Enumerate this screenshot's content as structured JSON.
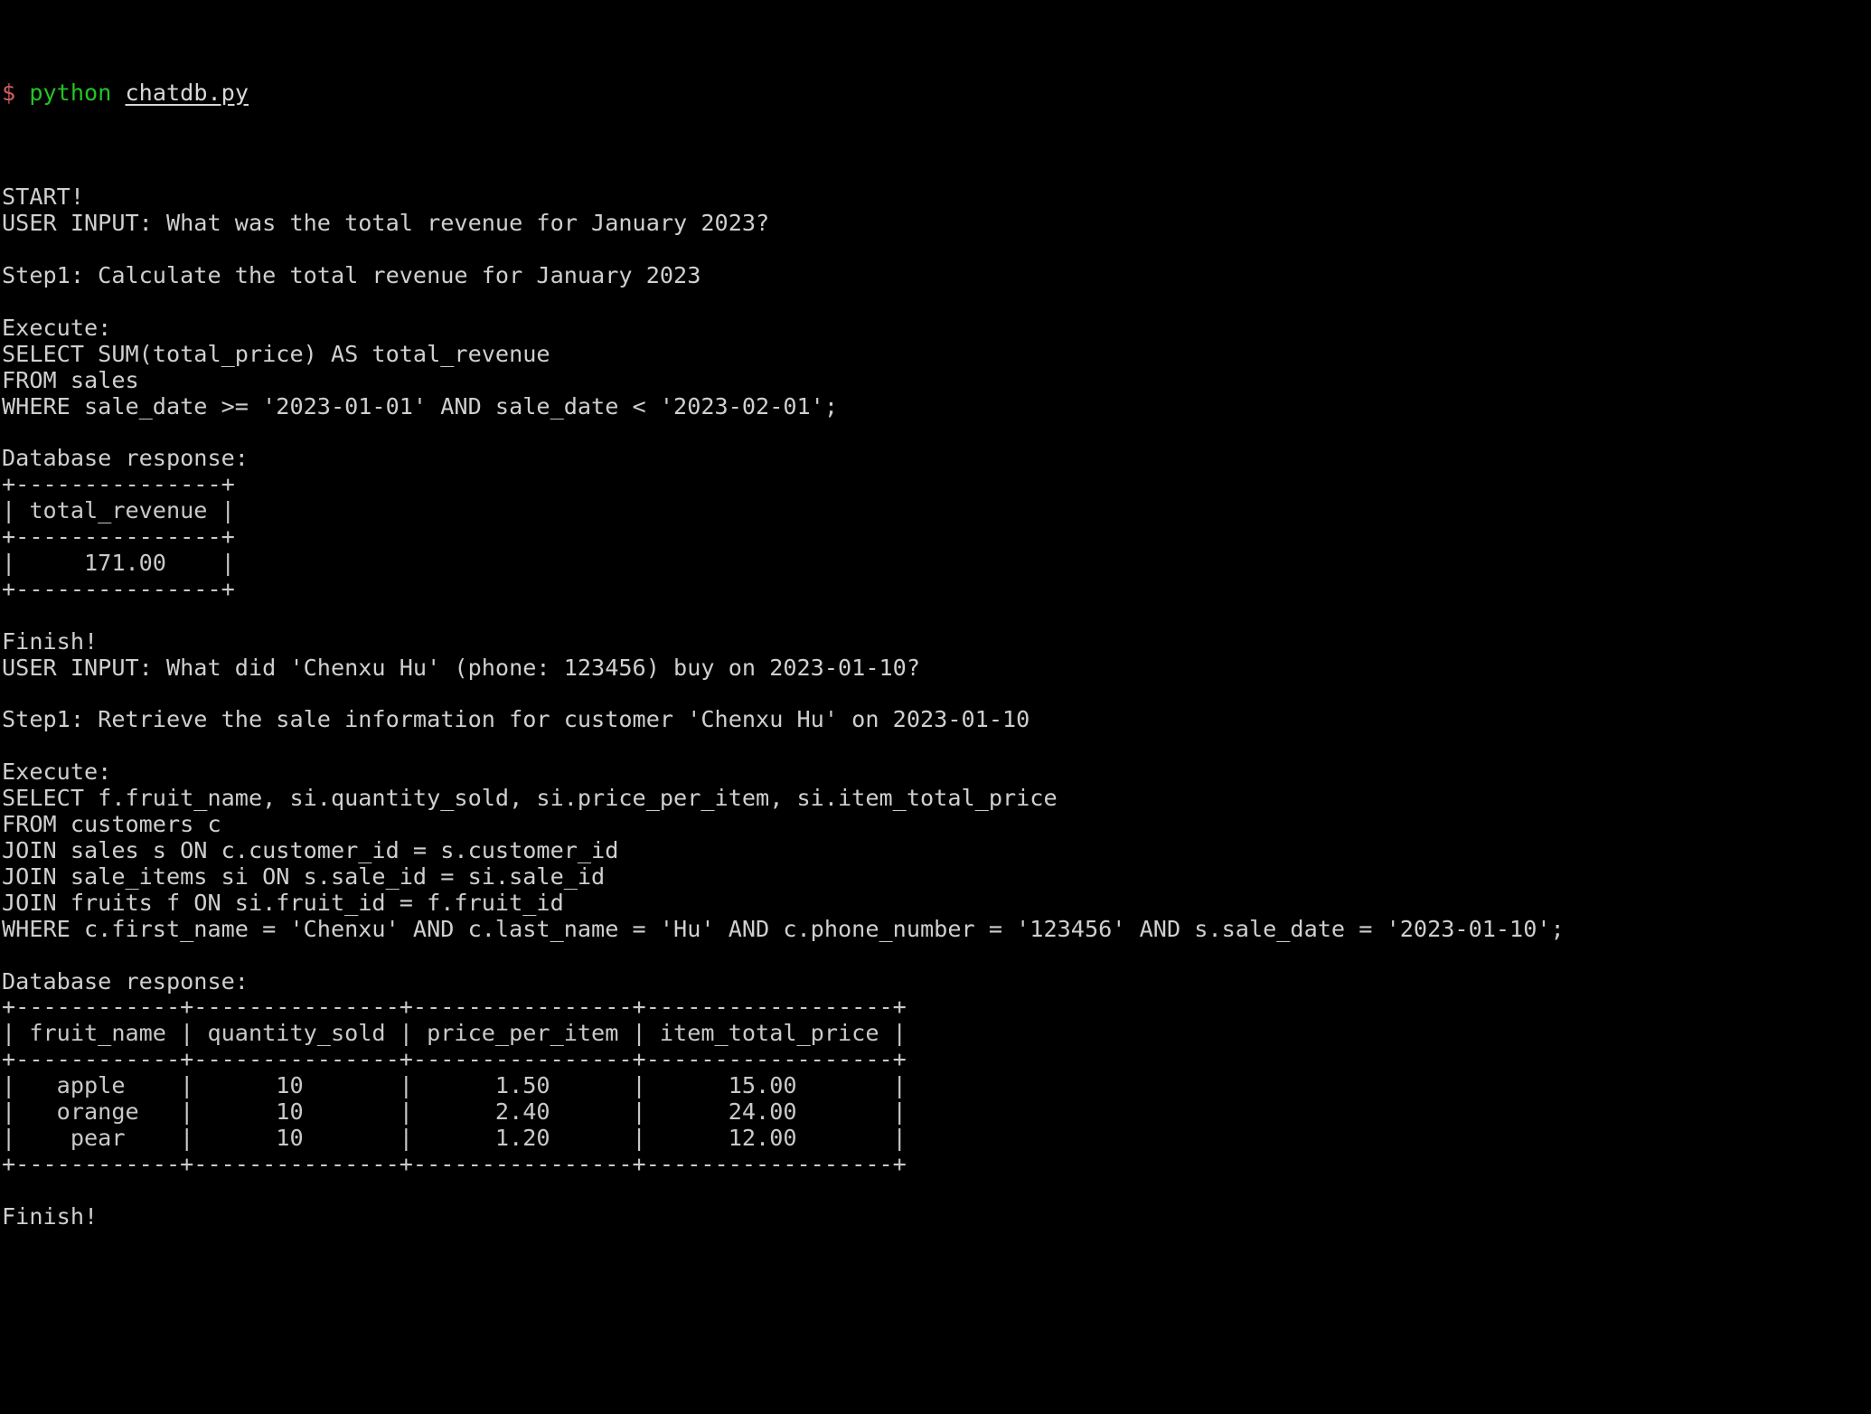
{
  "terminal": {
    "background_color": "#000000",
    "foreground_color": "#cccccc",
    "prompt_sigil_color": "#d45f5f",
    "command_color": "#22c522",
    "prompt": {
      "sigil": "$",
      "command": "python",
      "argument": "chatdb.py"
    }
  },
  "session": {
    "start_banner": "START!",
    "lines": [
      {
        "id": "l-start",
        "type": "output",
        "text": "START!"
      },
      {
        "id": "l-user1",
        "type": "output",
        "text": "USER INPUT: What was the total revenue for January 2023?"
      },
      {
        "id": "l-blank1",
        "type": "blank",
        "text": ""
      },
      {
        "id": "l-step1a",
        "type": "output",
        "text": "Step1: Calculate the total revenue for January 2023"
      },
      {
        "id": "l-blank2",
        "type": "blank",
        "text": ""
      },
      {
        "id": "l-exec1",
        "type": "output",
        "text": "Execute:"
      },
      {
        "id": "l-sql1a",
        "type": "sql",
        "text": "SELECT SUM(total_price) AS total_revenue"
      },
      {
        "id": "l-sql1b",
        "type": "sql",
        "text": "FROM sales"
      },
      {
        "id": "l-sql1c",
        "type": "sql",
        "text": "WHERE sale_date >= '2023-01-01' AND sale_date < '2023-02-01';"
      },
      {
        "id": "l-blank3",
        "type": "blank",
        "text": ""
      },
      {
        "id": "l-dbresp1",
        "type": "output",
        "text": "Database response:"
      },
      {
        "id": "l-t1-top",
        "type": "table",
        "text": "+---------------+"
      },
      {
        "id": "l-t1-hdr",
        "type": "table",
        "text": "| total_revenue |"
      },
      {
        "id": "l-t1-mid",
        "type": "table",
        "text": "+---------------+"
      },
      {
        "id": "l-t1-r1",
        "type": "table",
        "text": "|     171.00    |"
      },
      {
        "id": "l-t1-bot",
        "type": "table",
        "text": "+---------------+"
      },
      {
        "id": "l-blank4",
        "type": "blank",
        "text": ""
      },
      {
        "id": "l-finish1",
        "type": "output",
        "text": "Finish!"
      },
      {
        "id": "l-user2",
        "type": "output",
        "text": "USER INPUT: What did 'Chenxu Hu' (phone: 123456) buy on 2023-01-10?"
      },
      {
        "id": "l-blank5",
        "type": "blank",
        "text": ""
      },
      {
        "id": "l-step1b",
        "type": "output",
        "text": "Step1: Retrieve the sale information for customer 'Chenxu Hu' on 2023-01-10"
      },
      {
        "id": "l-blank6",
        "type": "blank",
        "text": ""
      },
      {
        "id": "l-exec2",
        "type": "output",
        "text": "Execute:"
      },
      {
        "id": "l-sql2a",
        "type": "sql",
        "text": "SELECT f.fruit_name, si.quantity_sold, si.price_per_item, si.item_total_price"
      },
      {
        "id": "l-sql2b",
        "type": "sql",
        "text": "FROM customers c"
      },
      {
        "id": "l-sql2c",
        "type": "sql",
        "text": "JOIN sales s ON c.customer_id = s.customer_id"
      },
      {
        "id": "l-sql2d",
        "type": "sql",
        "text": "JOIN sale_items si ON s.sale_id = si.sale_id"
      },
      {
        "id": "l-sql2e",
        "type": "sql",
        "text": "JOIN fruits f ON si.fruit_id = f.fruit_id"
      },
      {
        "id": "l-sql2f",
        "type": "sql",
        "text": "WHERE c.first_name = 'Chenxu' AND c.last_name = 'Hu' AND c.phone_number = '123456' AND s.sale_date = '2023-01-10';"
      },
      {
        "id": "l-blank7",
        "type": "blank",
        "text": ""
      },
      {
        "id": "l-dbresp2",
        "type": "output",
        "text": "Database response:"
      },
      {
        "id": "l-t2-top",
        "type": "table",
        "text": "+------------+---------------+----------------+------------------+"
      },
      {
        "id": "l-t2-hdr",
        "type": "table",
        "text": "| fruit_name | quantity_sold | price_per_item | item_total_price |"
      },
      {
        "id": "l-t2-mid",
        "type": "table",
        "text": "+------------+---------------+----------------+------------------+"
      },
      {
        "id": "l-t2-r1",
        "type": "table",
        "text": "|   apple    |      10       |      1.50      |      15.00       |"
      },
      {
        "id": "l-t2-r2",
        "type": "table",
        "text": "|   orange   |      10       |      2.40      |      24.00       |"
      },
      {
        "id": "l-t2-r3",
        "type": "table",
        "text": "|    pear    |      10       |      1.20      |      12.00       |"
      },
      {
        "id": "l-t2-bot",
        "type": "table",
        "text": "+------------+---------------+----------------+------------------+"
      },
      {
        "id": "l-blank8",
        "type": "blank",
        "text": ""
      },
      {
        "id": "l-finish2",
        "type": "output",
        "text": "Finish!"
      }
    ]
  },
  "queries": [
    {
      "user_input": "What was the total revenue for January 2023?",
      "step_label": "Step1: Calculate the total revenue for January 2023",
      "sql": "SELECT SUM(total_price) AS total_revenue\nFROM sales\nWHERE sale_date >= '2023-01-01' AND sale_date < '2023-02-01';",
      "response_label": "Database response:",
      "result": {
        "columns": [
          "total_revenue"
        ],
        "rows": [
          [
            "171.00"
          ]
        ]
      },
      "finish": "Finish!"
    },
    {
      "user_input": "What did 'Chenxu Hu' (phone: 123456) buy on 2023-01-10?",
      "step_label": "Step1: Retrieve the sale information for customer 'Chenxu Hu' on 2023-01-10",
      "sql": "SELECT f.fruit_name, si.quantity_sold, si.price_per_item, si.item_total_price\nFROM customers c\nJOIN sales s ON c.customer_id = s.customer_id\nJOIN sale_items si ON s.sale_id = si.sale_id\nJOIN fruits f ON si.fruit_id = f.fruit_id\nWHERE c.first_name = 'Chenxu' AND c.last_name = 'Hu' AND c.phone_number = '123456' AND s.sale_date = '2023-01-10';",
      "response_label": "Database response:",
      "result": {
        "columns": [
          "fruit_name",
          "quantity_sold",
          "price_per_item",
          "item_total_price"
        ],
        "rows": [
          [
            "apple",
            "10",
            "1.50",
            "15.00"
          ],
          [
            "orange",
            "10",
            "2.40",
            "24.00"
          ],
          [
            "pear",
            "10",
            "1.20",
            "12.00"
          ]
        ]
      },
      "finish": "Finish!"
    }
  ]
}
